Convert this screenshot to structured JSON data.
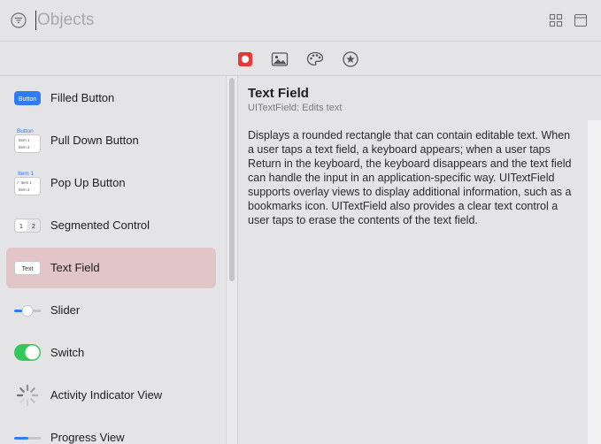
{
  "search": {
    "placeholder": "Objects",
    "value": ""
  },
  "header_icons": [
    "filter-icon",
    "grid-view-icon",
    "window-icon"
  ],
  "tabs": [
    {
      "name": "objects-tab",
      "icon": "record-icon",
      "selected": true,
      "accent": "#e8363b"
    },
    {
      "name": "media-tab",
      "icon": "photo-icon",
      "selected": false
    },
    {
      "name": "colors-tab",
      "icon": "palette-icon",
      "selected": false
    },
    {
      "name": "symbols-tab",
      "icon": "star-icon",
      "selected": false
    }
  ],
  "list": {
    "items": [
      {
        "label": "Filled Button",
        "thumb_text": "Button"
      },
      {
        "label": "Pull Down Button",
        "thumb_text": "Button",
        "thumb_rows": [
          "Item 1",
          "Item 2"
        ]
      },
      {
        "label": "Pop Up Button",
        "thumb_text": "Item 1",
        "thumb_rows": [
          "✓ Item 1",
          "Item 2"
        ]
      },
      {
        "label": "Segmented Control",
        "thumb_segments": [
          "1",
          "2"
        ]
      },
      {
        "label": "Text Field",
        "thumb_text": "Text",
        "selected": true
      },
      {
        "label": "Slider"
      },
      {
        "label": "Switch"
      },
      {
        "label": "Activity Indicator View"
      },
      {
        "label": "Progress View"
      }
    ]
  },
  "detail": {
    "title": "Text Field",
    "subtitle": "UITextField: Edits text",
    "description": "Displays a rounded rectangle that can contain editable text. When a user taps a text field, a keyboard appears; when a user taps Return in the keyboard, the keyboard disappears and the text field can handle the input in an application-specific way. UITextField supports overlay views to display additional information, such as a bookmarks icon. UITextField also provides a clear text control a user taps to erase the contents of the text field."
  },
  "colors": {
    "selection": "#e2c5c8",
    "accent_blue": "#2f7cf6",
    "switch_green": "#34c759",
    "record_red": "#e8363b"
  }
}
